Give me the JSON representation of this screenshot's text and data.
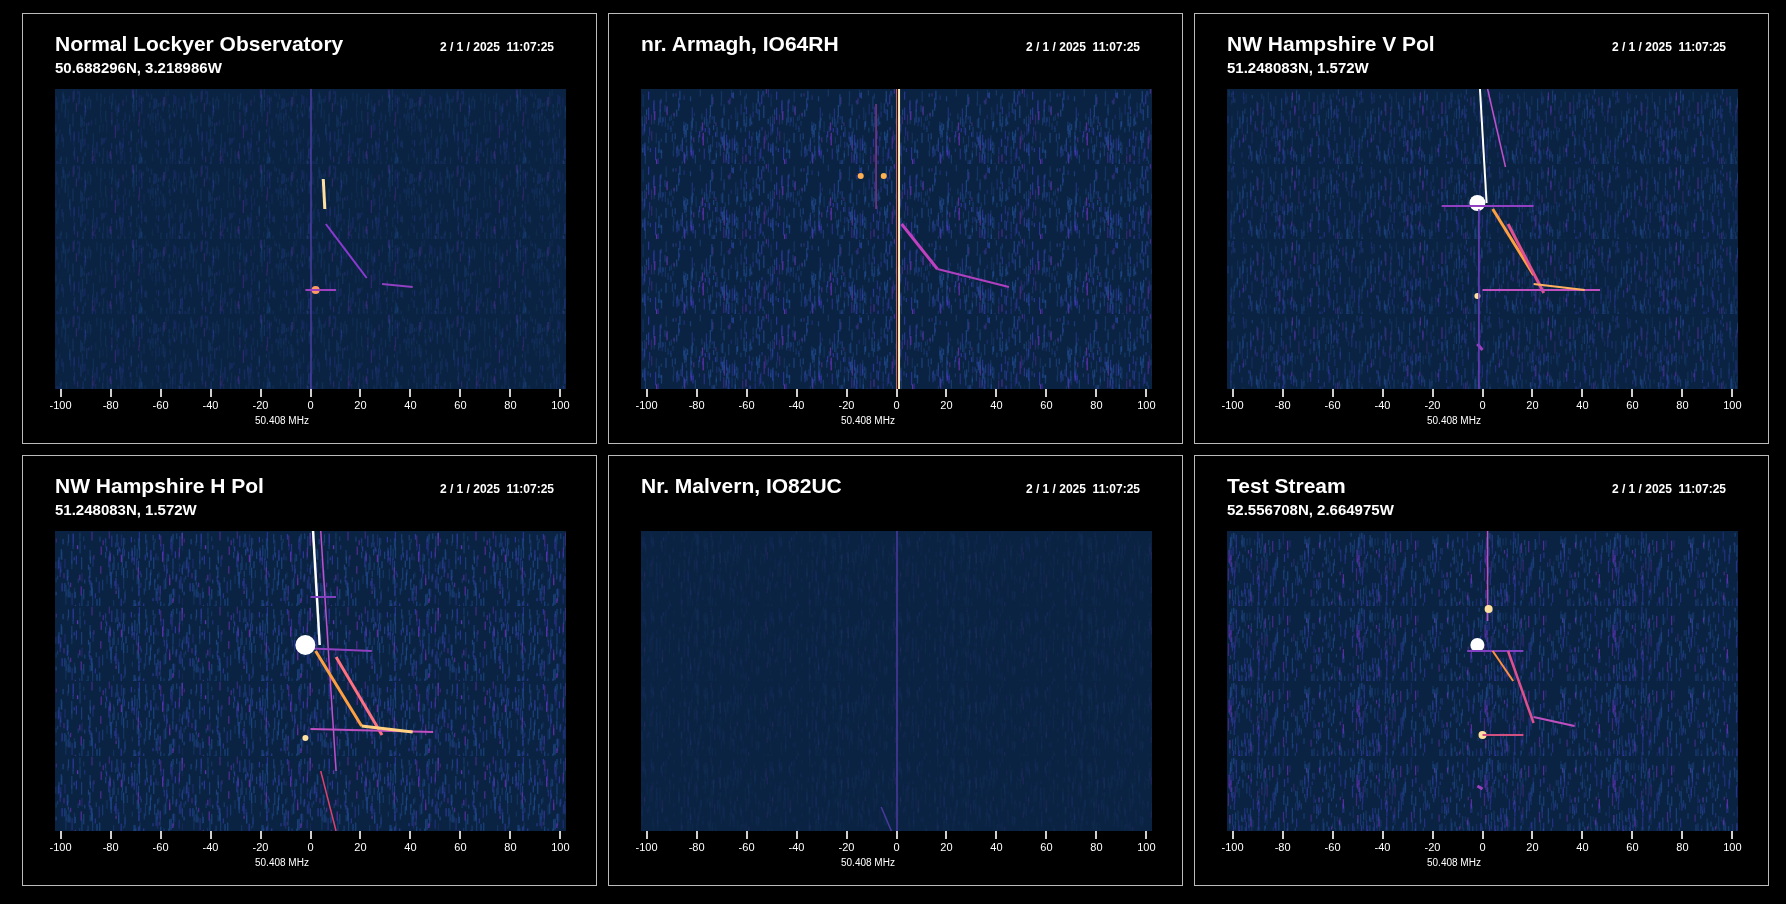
{
  "panels": [
    {
      "title": "Normal Lockyer Observatory",
      "coordinates": "50.688296N, 3.218986W",
      "timestamp": "2 / 1 / 2025  11:07:25",
      "axis": {
        "ticks": [
          "-100",
          "-80",
          "-60",
          "-40",
          "-20",
          "0",
          "20",
          "40",
          "60",
          "80",
          "100"
        ],
        "label": "50.408 MHz"
      }
    },
    {
      "title": "nr. Armagh, IO64RH",
      "timestamp": "2 / 1 / 2025  11:07:25",
      "axis": {
        "ticks": [
          "-100",
          "-80",
          "-60",
          "-40",
          "-20",
          "0",
          "20",
          "40",
          "60",
          "80",
          "100"
        ],
        "label": "50.408 MHz"
      }
    },
    {
      "title": "NW Hampshire V Pol",
      "coordinates": "51.248083N, 1.572W",
      "timestamp": "2 / 1 / 2025  11:07:25",
      "axis": {
        "ticks": [
          "-100",
          "-80",
          "-60",
          "-40",
          "-20",
          "0",
          "20",
          "40",
          "60",
          "80",
          "100"
        ],
        "label": "50.408 MHz"
      }
    },
    {
      "title": "NW Hampshire H Pol",
      "coordinates": "51.248083N, 1.572W",
      "timestamp": "2 / 1 / 2025  11:07:25",
      "axis": {
        "ticks": [
          "-100",
          "-80",
          "-60",
          "-40",
          "-20",
          "0",
          "20",
          "40",
          "60",
          "80",
          "100"
        ],
        "label": "50.408 MHz"
      }
    },
    {
      "title": "Nr. Malvern, IO82UC",
      "timestamp": "2 / 1 / 2025  11:07:25",
      "axis": {
        "ticks": [
          "-100",
          "-80",
          "-60",
          "-40",
          "-20",
          "0",
          "20",
          "40",
          "60",
          "80",
          "100"
        ],
        "label": "50.408 MHz"
      }
    },
    {
      "title": "Test Stream",
      "coordinates": "52.556708N, 2.664975W",
      "timestamp": "2 / 1 / 2025  11:07:25",
      "axis": {
        "ticks": [
          "-100",
          "-80",
          "-60",
          "-40",
          "-20",
          "0",
          "20",
          "40",
          "60",
          "80",
          "100"
        ],
        "label": "50.408 MHz"
      }
    }
  ]
}
